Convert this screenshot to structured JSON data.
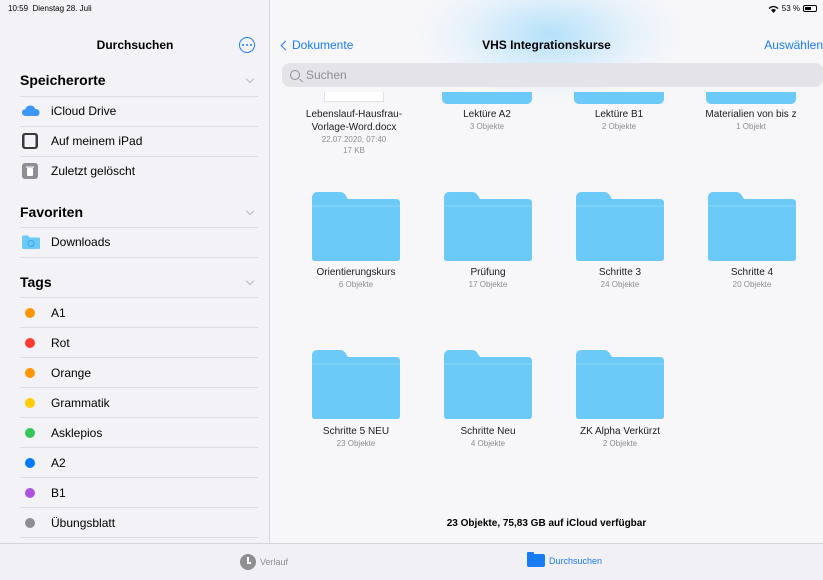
{
  "status": {
    "time": "10:59",
    "date": "Dienstag 28. Juli",
    "battery": "53 %"
  },
  "sidebar": {
    "title": "Durchsuchen",
    "locations_header": "Speicherorte",
    "locations": [
      {
        "label": "iCloud Drive",
        "icon": "icloud-icon"
      },
      {
        "label": "Auf meinem iPad",
        "icon": "ipad-icon"
      },
      {
        "label": "Zuletzt gelöscht",
        "icon": "trash-icon"
      }
    ],
    "favorites_header": "Favoriten",
    "favorites": [
      {
        "label": "Downloads",
        "icon": "downloads-folder-icon"
      }
    ],
    "tags_header": "Tags",
    "tags": [
      {
        "label": "A1",
        "color": "#ff9500"
      },
      {
        "label": "Rot",
        "color": "#ff3b30"
      },
      {
        "label": "Orange",
        "color": "#ff9500"
      },
      {
        "label": "Grammatik",
        "color": "#ffcc00"
      },
      {
        "label": "Asklepios",
        "color": "#34c759"
      },
      {
        "label": "A2",
        "color": "#007aff"
      },
      {
        "label": "B1",
        "color": "#af52de"
      },
      {
        "label": "Übungsblatt",
        "color": "#8e8e93"
      }
    ]
  },
  "main": {
    "back_label": "Dokumente",
    "title": "VHS Integrationskurse",
    "select_label": "Auswählen",
    "search_placeholder": "Suchen",
    "items_row1": [
      {
        "name": "Lebenslauf-Hausfrau-Vorlage-Word.docx",
        "sub": "22.07.2020, 07:40",
        "size": "17 KB",
        "type": "document"
      },
      {
        "name": "Lektüre A2",
        "sub": "3 Objekte",
        "type": "folder"
      },
      {
        "name": "Lektüre B1",
        "sub": "2 Objekte",
        "type": "folder"
      },
      {
        "name": "Materialien von  bis z",
        "sub": "1 Objekt",
        "type": "folder"
      }
    ],
    "items_row2": [
      {
        "name": "Orientierungskurs",
        "sub": "6 Objekte"
      },
      {
        "name": "Prüfung",
        "sub": "17 Objekte"
      },
      {
        "name": "Schritte 3",
        "sub": "24 Objekte"
      },
      {
        "name": "Schritte 4",
        "sub": "20 Objekte"
      }
    ],
    "items_row3": [
      {
        "name": "Schritte 5 NEU",
        "sub": "23 Objekte"
      },
      {
        "name": "Schritte Neu",
        "sub": "4 Objekte"
      },
      {
        "name": "ZK Alpha Verkürzt",
        "sub": "2 Objekte"
      }
    ],
    "footer": "23 Objekte, 75,83 GB auf iCloud verfügbar"
  },
  "tabbar": {
    "recents": "Verlauf",
    "browse": "Durchsuchen"
  },
  "colors": {
    "accent": "#1a7cf5",
    "folder": "#6ccaf8"
  }
}
